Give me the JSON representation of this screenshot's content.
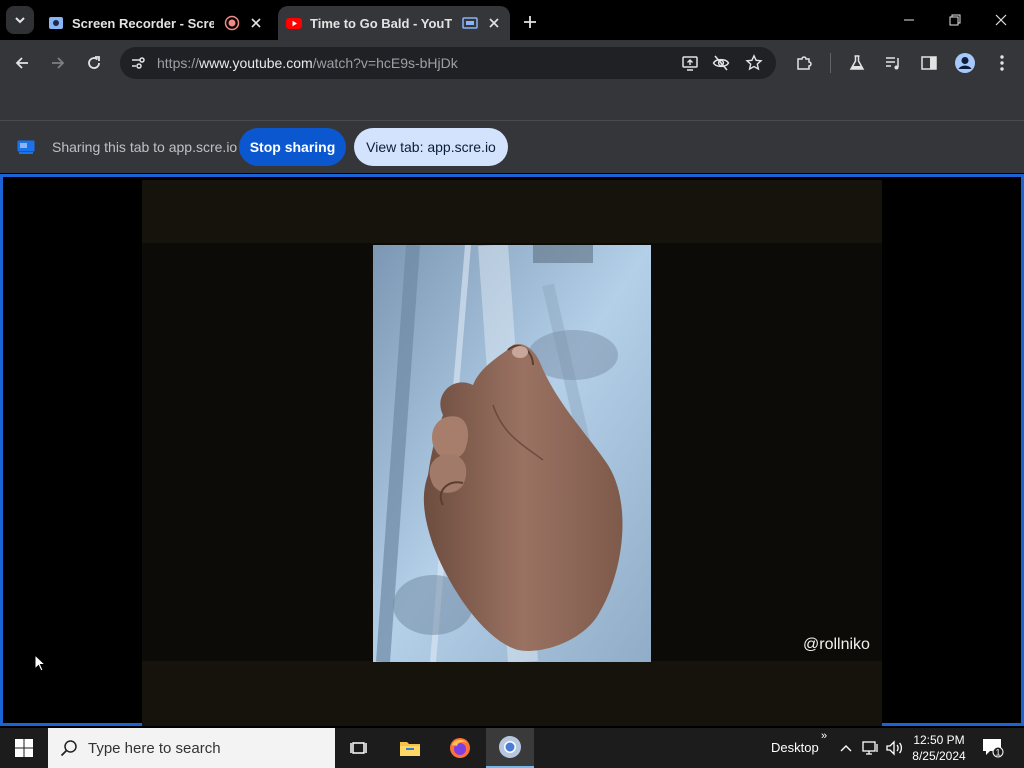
{
  "browser": {
    "tabs": [
      {
        "title": "Screen Recorder - Scre.io",
        "favicon": "screen-recorder-favicon",
        "status_icon": "recording-icon"
      },
      {
        "title": "Time to Go Bald - YouTube",
        "favicon": "youtube-favicon",
        "status_icon": "tab-sharing-icon",
        "active": true
      }
    ],
    "url": {
      "scheme": "https://",
      "domain": "www.youtube.com",
      "path": "/watch?v=hcE9s-bHjDk"
    }
  },
  "share_bar": {
    "message": "Sharing this tab to app.scre.io",
    "stop_button": "Stop sharing",
    "view_button": "View tab: app.scre.io"
  },
  "video": {
    "watermark": "@rollniko"
  },
  "taskbar": {
    "search_placeholder": "Type here to search",
    "desktop_label": "Desktop",
    "chevrons": "»",
    "time": "12:50 PM",
    "date": "8/25/2024",
    "notification_count": "1"
  },
  "colors": {
    "accent": "#0b57d0",
    "share_border": "#1a64d6",
    "recording": "#f28b82",
    "youtube_red": "#ff0000"
  }
}
